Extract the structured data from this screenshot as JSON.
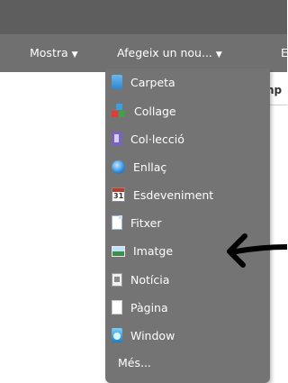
{
  "menubar": {
    "mostra_label": "Mostra",
    "afegeix_label": "Afegeix un nou...",
    "caret": "▼",
    "edge_item_label": "E"
  },
  "page": {
    "partial_text": "np"
  },
  "dropdown": {
    "items": [
      {
        "label": "Carpeta",
        "icon": "folder-icon"
      },
      {
        "label": "Collage",
        "icon": "collage-icon"
      },
      {
        "label": "Col·lecció",
        "icon": "collection-icon"
      },
      {
        "label": "Enllaç",
        "icon": "link-globe-icon"
      },
      {
        "label": "Esdeveniment",
        "icon": "calendar-icon"
      },
      {
        "label": "Fitxer",
        "icon": "file-icon"
      },
      {
        "label": "Imatge",
        "icon": "image-icon"
      },
      {
        "label": "Notícia",
        "icon": "news-icon"
      },
      {
        "label": "Pàgina",
        "icon": "page-icon"
      },
      {
        "label": "Window",
        "icon": "window-icon"
      }
    ],
    "more_label": "Més..."
  },
  "annotation": {
    "arrow_color": "#000000",
    "points_to": "Imatge"
  }
}
